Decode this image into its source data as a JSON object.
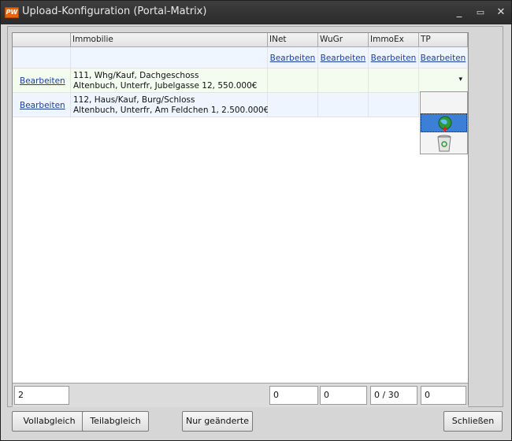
{
  "window": {
    "title": "Upload-Konfiguration (Portal-Matrix)",
    "icon_text": "PW",
    "minimize": "_",
    "maximize": "▭",
    "close": "✕"
  },
  "grid": {
    "headers": [
      "",
      "Immobilie",
      "INet",
      "WuGr",
      "ImmoEx",
      "TP"
    ],
    "top_row": {
      "edit_label": "Bearbeiten"
    },
    "rows": [
      {
        "edit": "Bearbeiten",
        "line1": "111, Whg/Kauf, Dachgeschoss",
        "line2": "Altenbuch,  Unterfr, Jubelgasse 12, 550.000€"
      },
      {
        "edit": "Bearbeiten",
        "line1": "112, Haus/Kauf, Burg/Schloss",
        "line2": "Altenbuch,  Unterfr, Am Feldchen 1, 2.500.000€"
      }
    ],
    "dropdown_arrow": "▾",
    "dropdown_items": [
      {
        "icon": "blank"
      },
      {
        "icon": "globe-upload-icon"
      },
      {
        "icon": "recycle-bin-icon"
      }
    ]
  },
  "footer": {
    "count": "2",
    "inet": "0",
    "wugr": "0",
    "immoex": "0 / 30",
    "tp": "0"
  },
  "buttons": {
    "full": "Vollabgleich",
    "partial": "Teilabgleich",
    "changed": "Nur geänderte",
    "close": "Schließen"
  }
}
